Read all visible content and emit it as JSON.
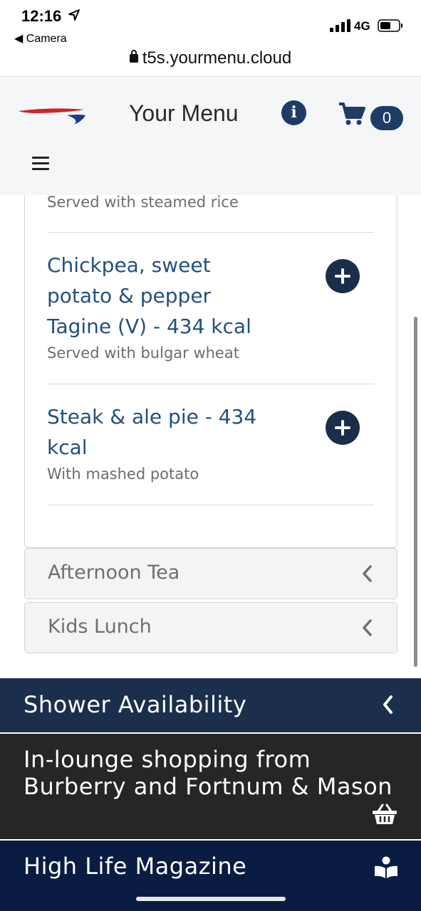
{
  "status_bar": {
    "time": "12:16",
    "back_app": "Camera",
    "network": "4G",
    "url": "t5s.yourmenu.cloud"
  },
  "header": {
    "title": "Your Menu",
    "cart_count": "0",
    "icons": [
      "airline-logo",
      "info-icon",
      "cart-icon",
      "hamburger-menu-icon"
    ]
  },
  "menu": {
    "top_item_description": "Served with steamed rice",
    "items": [
      {
        "title": "Chickpea, sweet potato & pepper Tagine (V) - 434 kcal",
        "description": "Served with bulgar wheat"
      },
      {
        "title": "Steak & ale pie - 434 kcal",
        "description": "With mashed potato"
      }
    ]
  },
  "accordion": [
    {
      "label": "Afternoon Tea"
    },
    {
      "label": "Kids Lunch"
    }
  ],
  "sections": [
    {
      "label": "Shower Availability"
    },
    {
      "label": "In-lounge shopping from Burberry and Fortnum & Mason"
    },
    {
      "label": "High Life Magazine"
    }
  ],
  "colors": {
    "header_bg": "#f4f6f8",
    "brand_blue": "#1f3b66",
    "item_title": "#24507e",
    "shower_bg": "#1b2f4d",
    "shopping_bg": "#262626",
    "highlife_bg": "#0b1c42"
  }
}
